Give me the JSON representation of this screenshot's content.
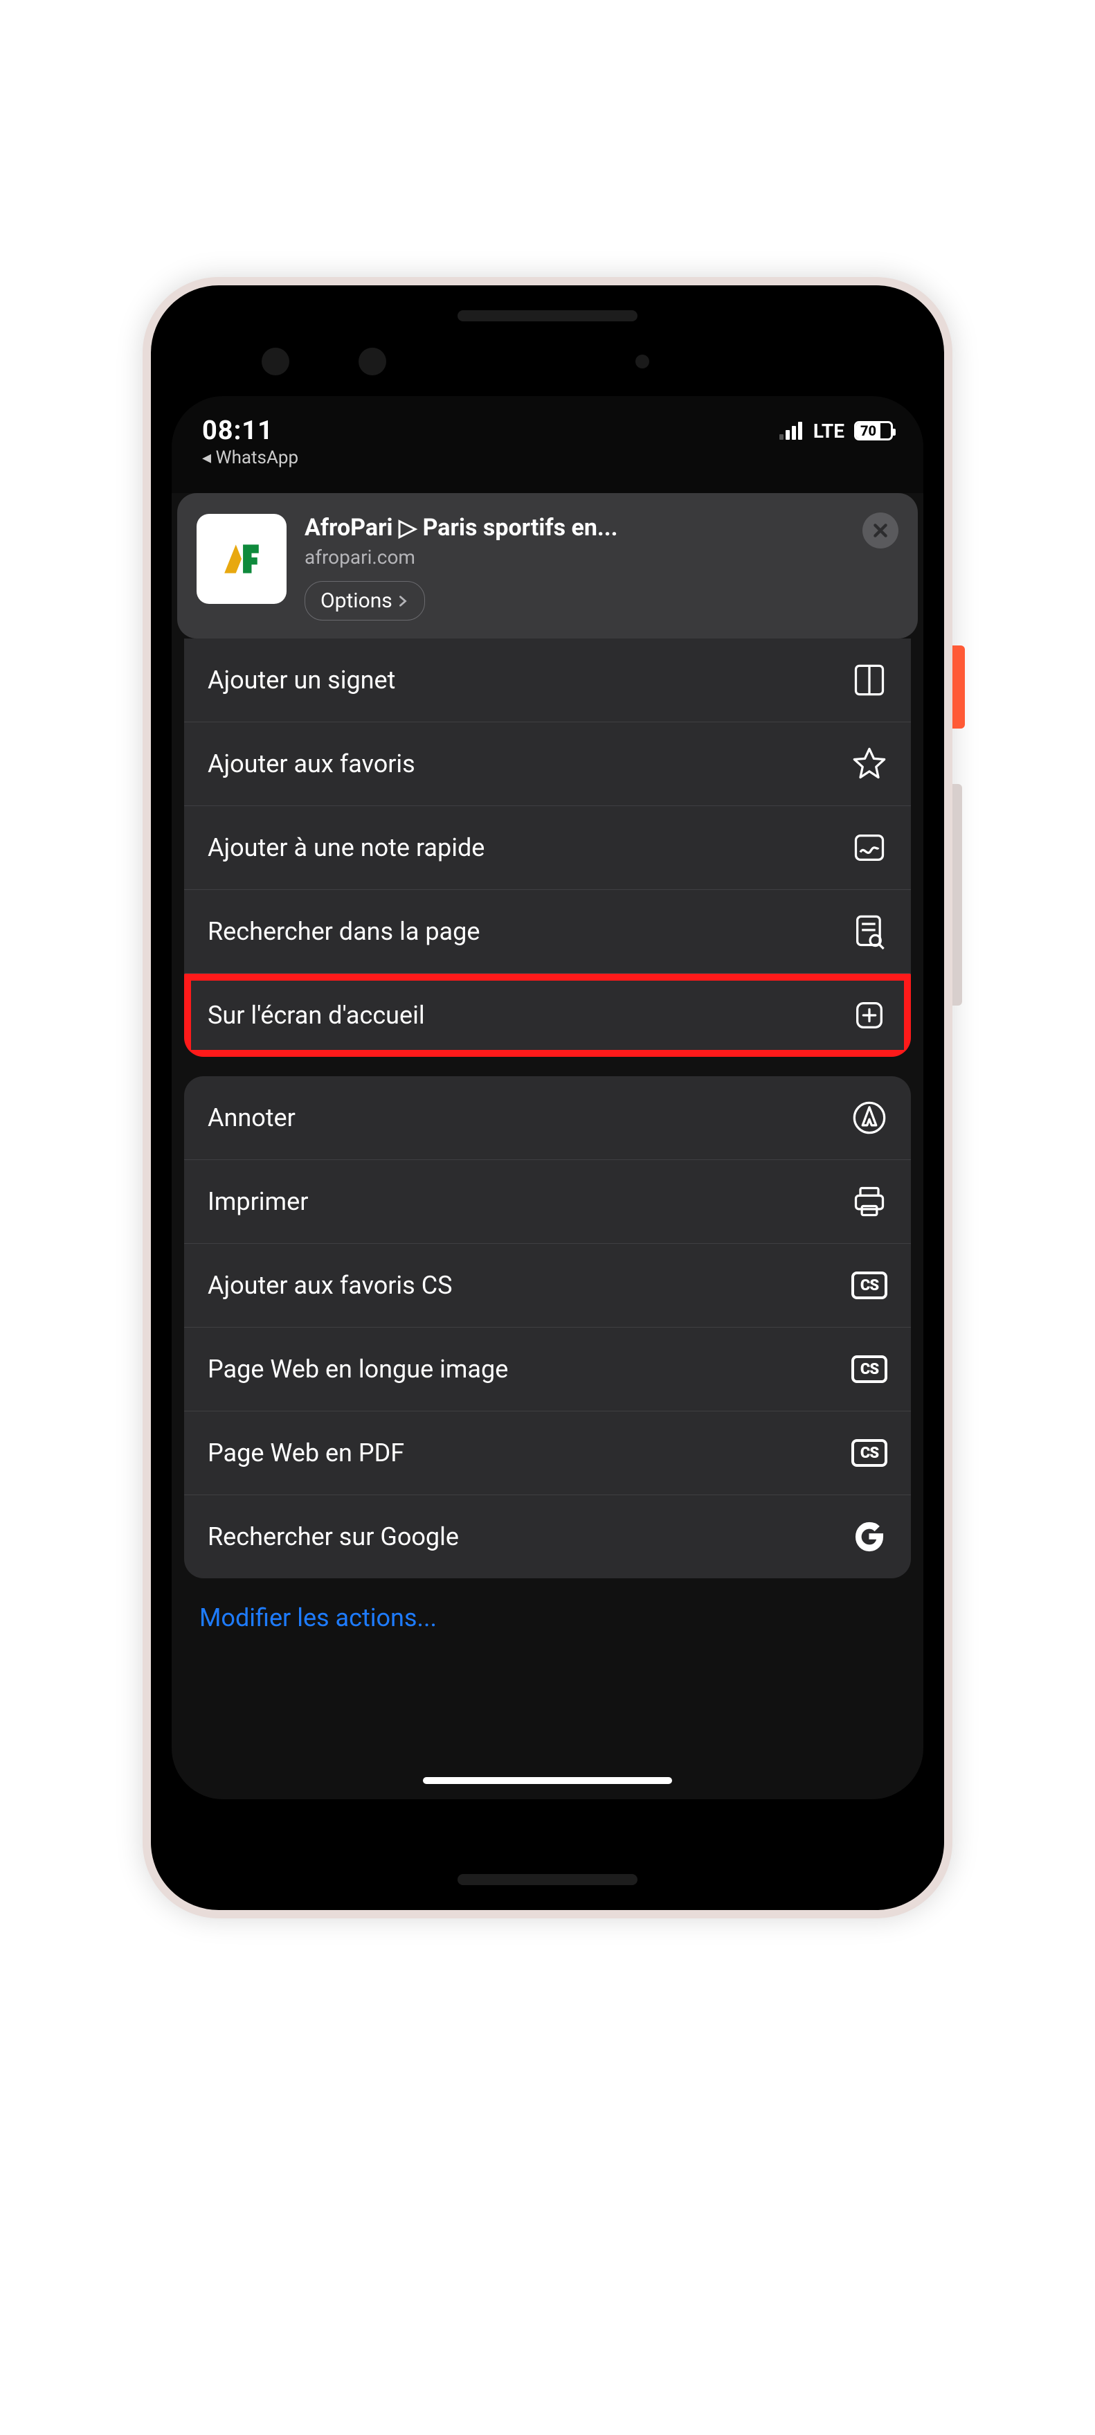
{
  "status": {
    "time": "08:11",
    "back_app": "◂ WhatsApp",
    "network_label": "LTE",
    "battery_pct": "70"
  },
  "sheet": {
    "title": "AfroPari ▷ Paris sportifs en...",
    "url": "afropari.com",
    "options_label": "Options"
  },
  "group1": [
    {
      "label": "Ajouter un signet",
      "icon": "book"
    },
    {
      "label": "Ajouter aux favoris",
      "icon": "star"
    },
    {
      "label": "Ajouter à une note rapide",
      "icon": "note"
    },
    {
      "label": "Rechercher dans la page",
      "icon": "find"
    },
    {
      "label": "Sur l'écran d'accueil",
      "icon": "add-home",
      "highlighted": true
    }
  ],
  "group2": [
    {
      "label": "Annoter",
      "icon": "markup"
    },
    {
      "label": "Imprimer",
      "icon": "print"
    },
    {
      "label": "Ajouter aux favoris CS",
      "icon": "cs"
    },
    {
      "label": "Page Web en longue image",
      "icon": "cs"
    },
    {
      "label": "Page Web en PDF",
      "icon": "cs"
    },
    {
      "label": "Rechercher sur Google",
      "icon": "google"
    }
  ],
  "edit_actions": "Modifier les actions..."
}
